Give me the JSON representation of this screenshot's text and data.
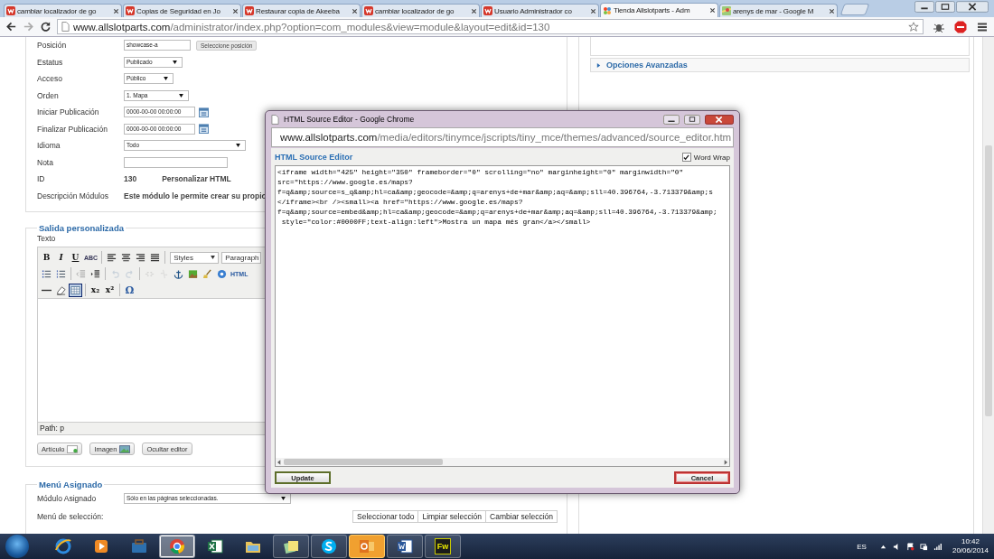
{
  "browser": {
    "tabs": [
      {
        "title": "cambiar localizador de go",
        "kind": "w",
        "selected": false
      },
      {
        "title": "Copias de Seguridad en Jo",
        "kind": "w",
        "selected": false
      },
      {
        "title": "Restaurar copia de Akeeba",
        "kind": "w",
        "selected": false
      },
      {
        "title": "cambiar localizador de go",
        "kind": "w",
        "selected": false
      },
      {
        "title": "Usuario Administrador co",
        "kind": "w",
        "selected": false
      },
      {
        "title": "Tienda Allslotparts - Adm",
        "kind": "joomla",
        "selected": true
      },
      {
        "title": "arenys de mar - Google M",
        "kind": "maps",
        "selected": false
      }
    ],
    "address": {
      "host": "www.allslotparts.com",
      "path": "/administrator/index.php?option=com_modules&view=module&layout=edit&id=130"
    }
  },
  "module_details": {
    "rows": [
      {
        "label": "Posición",
        "kind": "position",
        "value": "showcase-a",
        "button": "Seleccione posición"
      },
      {
        "label": "Estatus",
        "kind": "select",
        "value": "Publicado"
      },
      {
        "label": "Acceso",
        "kind": "select",
        "value": "Público"
      },
      {
        "label": "Orden",
        "kind": "select",
        "value": "1. Mapa"
      },
      {
        "label": "Iniciar Publicación",
        "kind": "date",
        "value": "0000-00-00 00:00:00"
      },
      {
        "label": "Finalizar Publicación",
        "kind": "date",
        "value": "0000-00-00 00:00:00"
      },
      {
        "label": "Idioma",
        "kind": "select",
        "value": "Todo"
      },
      {
        "label": "Nota",
        "kind": "input"
      },
      {
        "label": "ID",
        "kind": "text",
        "value": "130",
        "extra": "Personalizar HTML"
      },
      {
        "label": "Descripción Módulos",
        "kind": "text",
        "value": "Este módulo le permite crear su propio"
      }
    ]
  },
  "editor": {
    "legend": "Salida personalizada",
    "label": "Texto",
    "styles": "Styles",
    "format": "Paragraph",
    "path": "Path: p",
    "toolbar": [
      [
        {
          "kind": "bold",
          "label": "B",
          "disabled": false,
          "active": false
        },
        {
          "kind": "italic",
          "label": "I",
          "disabled": false,
          "active": false
        },
        {
          "kind": "underline",
          "label": "U",
          "disabled": false,
          "active": false
        },
        {
          "kind": "strike",
          "label": "ABC",
          "disabled": false,
          "active": false
        },
        {
          "kind": "sep"
        },
        {
          "kind": "align-left",
          "disabled": false,
          "active": false
        },
        {
          "kind": "align-center",
          "disabled": false,
          "active": false
        },
        {
          "kind": "align-right",
          "disabled": false,
          "active": false
        },
        {
          "kind": "align-justify",
          "disabled": false,
          "active": false
        },
        {
          "kind": "sep"
        }
      ],
      [
        {
          "kind": "bullets",
          "disabled": false,
          "active": false
        },
        {
          "kind": "numbers",
          "disabled": false,
          "active": false
        },
        {
          "kind": "sep"
        },
        {
          "kind": "outdent",
          "disabled": false,
          "active": false
        },
        {
          "kind": "indent",
          "disabled": false,
          "active": false
        },
        {
          "kind": "sep"
        },
        {
          "kind": "undo",
          "disabled": true,
          "active": false
        },
        {
          "kind": "redo",
          "disabled": true,
          "active": false
        },
        {
          "kind": "sep"
        },
        {
          "kind": "link",
          "disabled": true,
          "active": false
        },
        {
          "kind": "unlink",
          "disabled": true,
          "active": false
        },
        {
          "kind": "anchor",
          "disabled": false,
          "active": false
        },
        {
          "kind": "image",
          "disabled": false,
          "active": false
        },
        {
          "kind": "cleanup",
          "disabled": false,
          "active": false
        },
        {
          "kind": "help",
          "disabled": false,
          "active": false
        },
        {
          "kind": "html",
          "label": "HTML",
          "disabled": false,
          "active": false
        }
      ],
      [
        {
          "kind": "rule",
          "disabled": false,
          "active": false
        },
        {
          "kind": "eraser",
          "disabled": false,
          "active": false
        },
        {
          "kind": "table",
          "disabled": false,
          "active": true
        },
        {
          "kind": "sep"
        },
        {
          "kind": "sub",
          "label": "x₂",
          "disabled": false,
          "active": false
        },
        {
          "kind": "sup",
          "label": "x²",
          "disabled": false,
          "active": false
        },
        {
          "kind": "sep"
        },
        {
          "kind": "charmap",
          "label": "Ω",
          "disabled": false,
          "active": false
        }
      ]
    ],
    "buttons": [
      {
        "label": "Artículo",
        "kind": "article"
      },
      {
        "label": "Imagen",
        "kind": "image"
      },
      {
        "label": "Ocultar editor",
        "kind": "plain"
      }
    ]
  },
  "menu": {
    "legend": "Menú Asignado",
    "assign_label": "Módulo Asignado",
    "assign_value": "Sólo en las páginas seleccionadas.",
    "selection_label": "Menú de selección:",
    "buttons": [
      "Seleccionar todo",
      "Limpiar selección",
      "Cambiar selección"
    ]
  },
  "right_panel": {
    "section": "Opciones Avanzadas",
    "expanded": false
  },
  "popup": {
    "title": "HTML Source Editor - Google Chrome",
    "address": {
      "host": "www.allslotparts.com",
      "path": "/media/editors/tinymce/jscripts/tiny_mce/themes/advanced/source_editor.htm"
    },
    "heading": "HTML Source Editor",
    "word_wrap": {
      "label": "Word Wrap",
      "checked": true
    },
    "source_lines": [
      "<iframe width=\"425\" height=\"350\" frameborder=\"0\" scrolling=\"no\" marginheight=\"0\" marginwidth=\"0\"",
      "src=\"https://www.google.es/maps?",
      "f=q&amp;source=s_q&amp;hl=ca&amp;geocode=&amp;q=arenys+de+mar&amp;aq=&amp;sll=40.396764,-3.713379&amp;s",
      "</iframe><br /><small><a href=\"https://www.google.es/maps?",
      "f=q&amp;source=embed&amp;hl=ca&amp;geocode=&amp;q=arenys+de+mar&amp;aq=&amp;sll=40.396764,-3.713379&amp;",
      " style=\"color:#0000FF;text-align:left\">Mostra un mapa més gran</a></small>"
    ],
    "buttons": [
      {
        "label": "Update",
        "kind": "update"
      },
      {
        "label": "Cancel",
        "kind": "cancel"
      }
    ]
  },
  "taskbar": {
    "apps": [
      {
        "kind": "ie",
        "running": false,
        "selected": false,
        "flashing": false
      },
      {
        "kind": "media",
        "running": false,
        "selected": false,
        "flashing": false
      },
      {
        "kind": "toolbox",
        "running": false,
        "selected": false,
        "flashing": false
      },
      {
        "kind": "chrome",
        "running": true,
        "selected": true,
        "flashing": false
      },
      {
        "kind": "excel",
        "running": false,
        "selected": false,
        "flashing": false
      },
      {
        "kind": "explorer",
        "running": false,
        "selected": false,
        "flashing": false
      },
      {
        "kind": "notes",
        "running": true,
        "selected": false,
        "flashing": false
      },
      {
        "kind": "skype",
        "running": true,
        "selected": false,
        "flashing": false
      },
      {
        "kind": "outlook",
        "running": true,
        "selected": false,
        "flashing": true
      },
      {
        "kind": "word",
        "running": true,
        "selected": false,
        "flashing": false
      },
      {
        "kind": "fireworks",
        "label": "Fw",
        "running": true,
        "selected": false,
        "flashing": false
      }
    ],
    "language": "ES",
    "time": "10:42",
    "date": "20/06/2014"
  }
}
